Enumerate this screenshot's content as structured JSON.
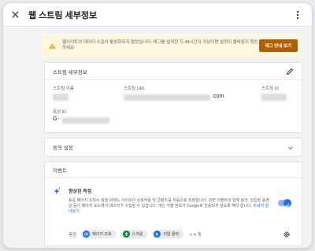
{
  "header": {
    "title": "웹 스트림 세부정보"
  },
  "alert": {
    "text": "웹사이트의 데이터 수집이 활성화되지 않았습니다. 태그를 설치한 지 48시간이 지났다면 설정이 올바른지 확인하세요",
    "button_label": "태그 안내 보기"
  },
  "stream_details": {
    "section_title": "스트림 세부정보",
    "name_label": "스트림 이름",
    "url_label": "스트림 URL",
    "url_value_visible": ".com",
    "id_label": "스트림 ID",
    "measurement_label": "측정 ID",
    "measurement_value_visible": "G-"
  },
  "consent": {
    "title": "동의 설정"
  },
  "events": {
    "section_title": "이벤트",
    "enhanced_title": "향상된 측정",
    "enhanced_desc": "표준 페이지 조회수 측정 외에도 사이트의 상호작용 및 콘텐츠를 자동으로 측정합니다. 관련 이벤트와 함께 링크, 삽입된 동영상 등의 페이지 요소에서 데이터가 수집될 수 있습니다. 개인 식별 정보가 Google로 전송되지 않도록 해야 합니다.",
    "learn_more": "자세히 알아보기",
    "measuring_label": "측정",
    "chips": [
      {
        "label": "페이지 조회",
        "color": "#1a73e8",
        "icon": "eye-icon"
      },
      {
        "label": "스크롤",
        "color": "#188038",
        "icon": "scroll-icon"
      },
      {
        "label": "이탈 클릭",
        "color": "#1a73e8",
        "icon": "cursor-icon"
      }
    ],
    "more_count": "+ 4 개"
  },
  "colors": {
    "accent": "#1a73e8",
    "warning_bg": "#fef7e0",
    "warning_button": "#b06000"
  }
}
